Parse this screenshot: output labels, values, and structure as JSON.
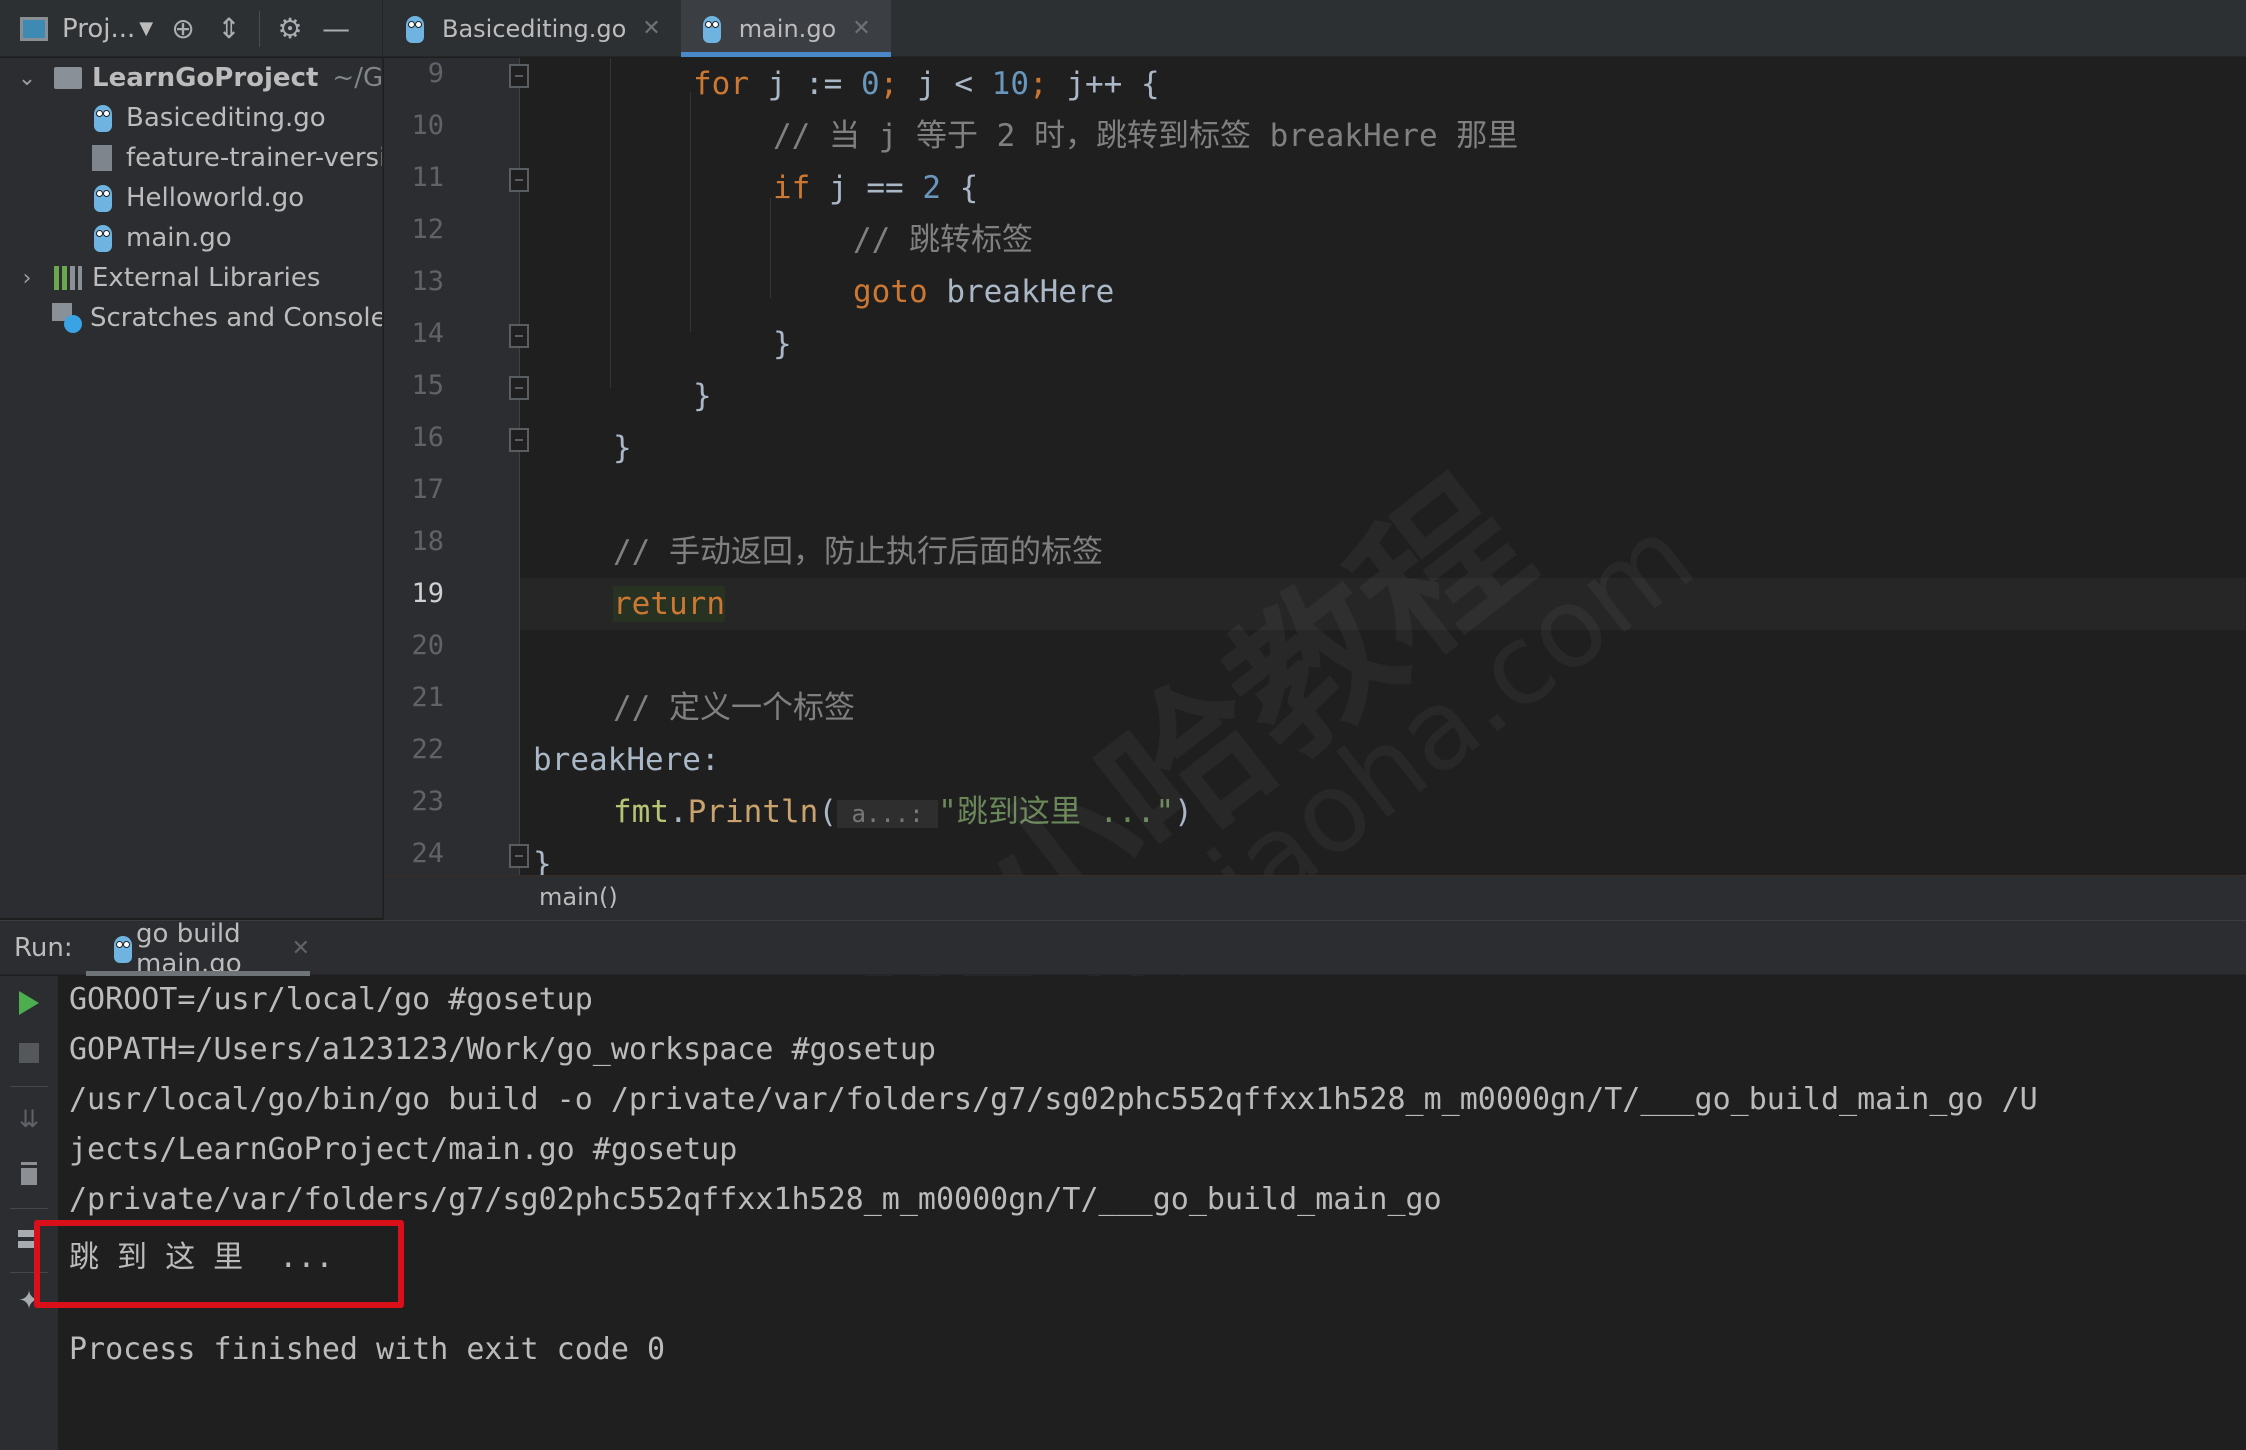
{
  "toolbar": {
    "project_label": "Proj...",
    "icons": [
      "project-window-icon",
      "locate-icon",
      "collapse-icon",
      "gear-icon",
      "minimize-icon"
    ]
  },
  "tabs": [
    {
      "label": "Basicediting.go",
      "active": false
    },
    {
      "label": "main.go",
      "active": true
    }
  ],
  "project_tree": {
    "root": {
      "name": "LearnGoProject",
      "path": "~/Gol"
    },
    "files": [
      "Basicediting.go",
      "feature-trainer-versi",
      "Helloworld.go",
      "main.go"
    ],
    "external": "External Libraries",
    "scratches": "Scratches and Console"
  },
  "editor": {
    "current_line": 19,
    "line_numbers": [
      "9",
      "10",
      "11",
      "12",
      "13",
      "14",
      "15",
      "16",
      "17",
      "18",
      "19",
      "20",
      "21",
      "22",
      "23",
      "24"
    ],
    "lines": {
      "l9": {
        "for": "for",
        "a": " j := ",
        "zero": "0",
        "semi1": ";",
        "b": " j < ",
        "ten": "10",
        "semi2": ";",
        "c": " j++ {"
      },
      "l10": "// 当 j 等于 2 时，跳转到标签 breakHere 那里",
      "l11": {
        "if": "if",
        "a": " j == ",
        "two": "2",
        "b": " {"
      },
      "l12": "// 跳转标签",
      "l13": {
        "goto": "goto",
        "label": " breakHere"
      },
      "l14": "}",
      "l15": "}",
      "l16": "}",
      "l18": "// 手动返回，防止执行后面的标签",
      "l19": "return",
      "l21": "// 定义一个标签",
      "l22": "breakHere:",
      "l23": {
        "pkg": "fmt",
        "dot": ".",
        "fn": "Println",
        "open": "(",
        "hint": " a...: ",
        "str": "\"跳到这里 ...\"",
        "close": ")"
      },
      "l24": "}"
    },
    "breadcrumb": "main()"
  },
  "run": {
    "label": "Run:",
    "tab": "go build main.go",
    "output": [
      "GOROOT=/usr/local/go #gosetup",
      "GOPATH=/Users/a123123/Work/go_workspace #gosetup",
      "/usr/local/go/bin/go build -o /private/var/folders/g7/sg02phc552qffxx1h528_m_m0000gn/T/___go_build_main_go /U",
      "jects/LearnGoProject/main.go #gosetup",
      "/private/var/folders/g7/sg02phc552qffxx1h528_m_m0000gn/T/___go_build_main_go",
      "跳 到 这 里  ...",
      "",
      "Process finished with exit code 0"
    ],
    "highlight_color": "#d9101a"
  },
  "watermark": {
    "text": "犬小哈教程",
    "url": "quanxiaoha.com"
  },
  "colors": {
    "keyword": "#cc7832",
    "number": "#6897bb",
    "comment": "#808080",
    "string": "#6a8759",
    "accent": "#4a88c7",
    "run_green": "#4cae4f"
  }
}
